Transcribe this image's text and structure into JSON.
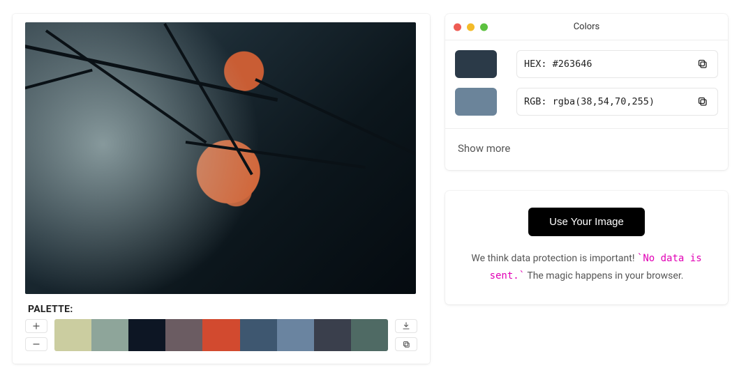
{
  "left": {
    "palette_label": "PALETTE:",
    "swatches": [
      "#cbcda0",
      "#8ea59a",
      "#0d1624",
      "#6b5c62",
      "#d24a2f",
      "#3e5770",
      "#6a84a0",
      "#3a3f4c",
      "#4f6a64"
    ]
  },
  "colors_panel": {
    "title": "Colors",
    "rows": [
      {
        "chip": "#2b3a48",
        "label": "HEX:",
        "value": "#263646"
      },
      {
        "chip": "#6b849a",
        "label": "RGB:",
        "value": "rgba(38,54,70,255)"
      }
    ],
    "show_more": "Show more"
  },
  "upload": {
    "button": "Use Your Image",
    "line1": "We think data protection is important! ",
    "code": "`No data is sent.`",
    "line2": " The magic happens in your browser."
  }
}
